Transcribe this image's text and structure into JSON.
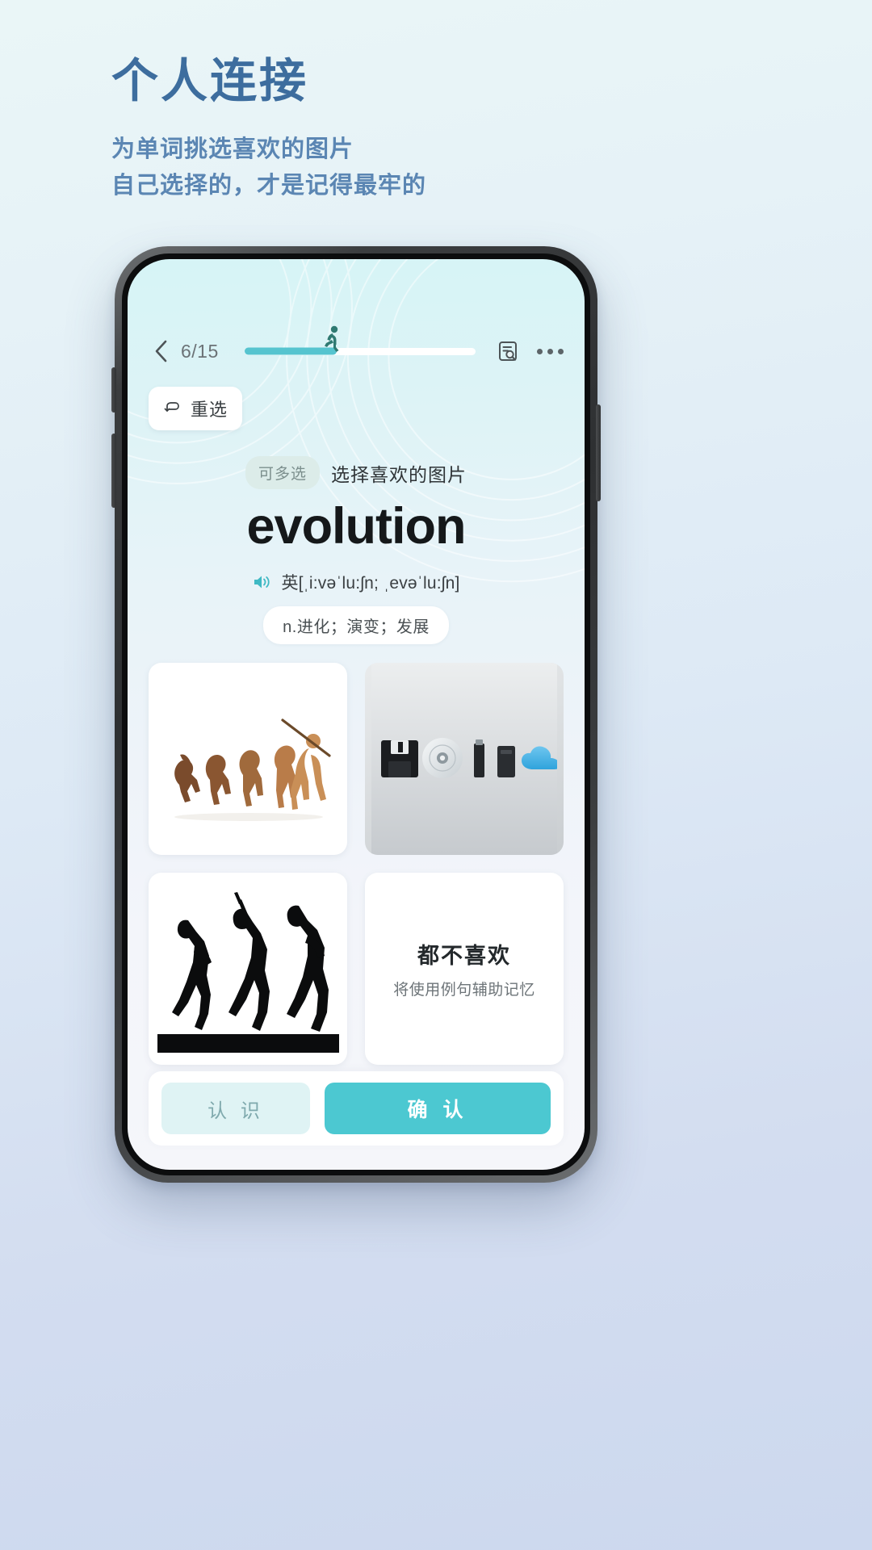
{
  "poster": {
    "title": "个人连接",
    "subtitle_line1": "为单词挑选喜欢的图片",
    "subtitle_line2": "自己选择的，才是记得最牢的",
    "title_color": "#3d6d9e",
    "subtitle_color": "#5b86b3"
  },
  "navbar": {
    "back_icon": "chevron-left-icon",
    "progress_label": "6/15",
    "progress_current": 6,
    "progress_total": 15,
    "progress_percent": 40,
    "runner_icon": "running-person-icon",
    "note_icon": "note-search-icon",
    "more_icon": "more-horizontal-icon",
    "progress_fill_color": "#56c4cf"
  },
  "reselect": {
    "icon": "undo-arrow-icon",
    "label": "重选"
  },
  "word_card": {
    "badge": "可多选",
    "hint": "选择喜欢的图片",
    "word": "evolution",
    "speaker_icon": "speaker-icon",
    "phonetic": "英[ˌi:vəˈlu:ʃn; ˌevəˈlu:ʃn]",
    "definition": "n.进化；演变；发展",
    "badge_bg": "#dcece9"
  },
  "image_grid": [
    {
      "name": "march-of-progress-color",
      "type": "image",
      "alt": "人类进化示意图（彩色）"
    },
    {
      "name": "storage-media-evolution",
      "type": "image",
      "alt": "存储介质演变示意图"
    },
    {
      "name": "march-of-progress-silhouette",
      "type": "image",
      "alt": "人类进化剪影"
    },
    {
      "name": "none-liked-option",
      "type": "option",
      "title": "都不喜欢",
      "subtitle": "将使用例句辅助记忆"
    }
  ],
  "actions": {
    "know_label": "认 识",
    "confirm_label": "确 认",
    "know_bg": "#dff3f4",
    "know_color": "#7fa9ad",
    "confirm_bg": "#4cc8d1",
    "confirm_color": "#ffffff"
  }
}
